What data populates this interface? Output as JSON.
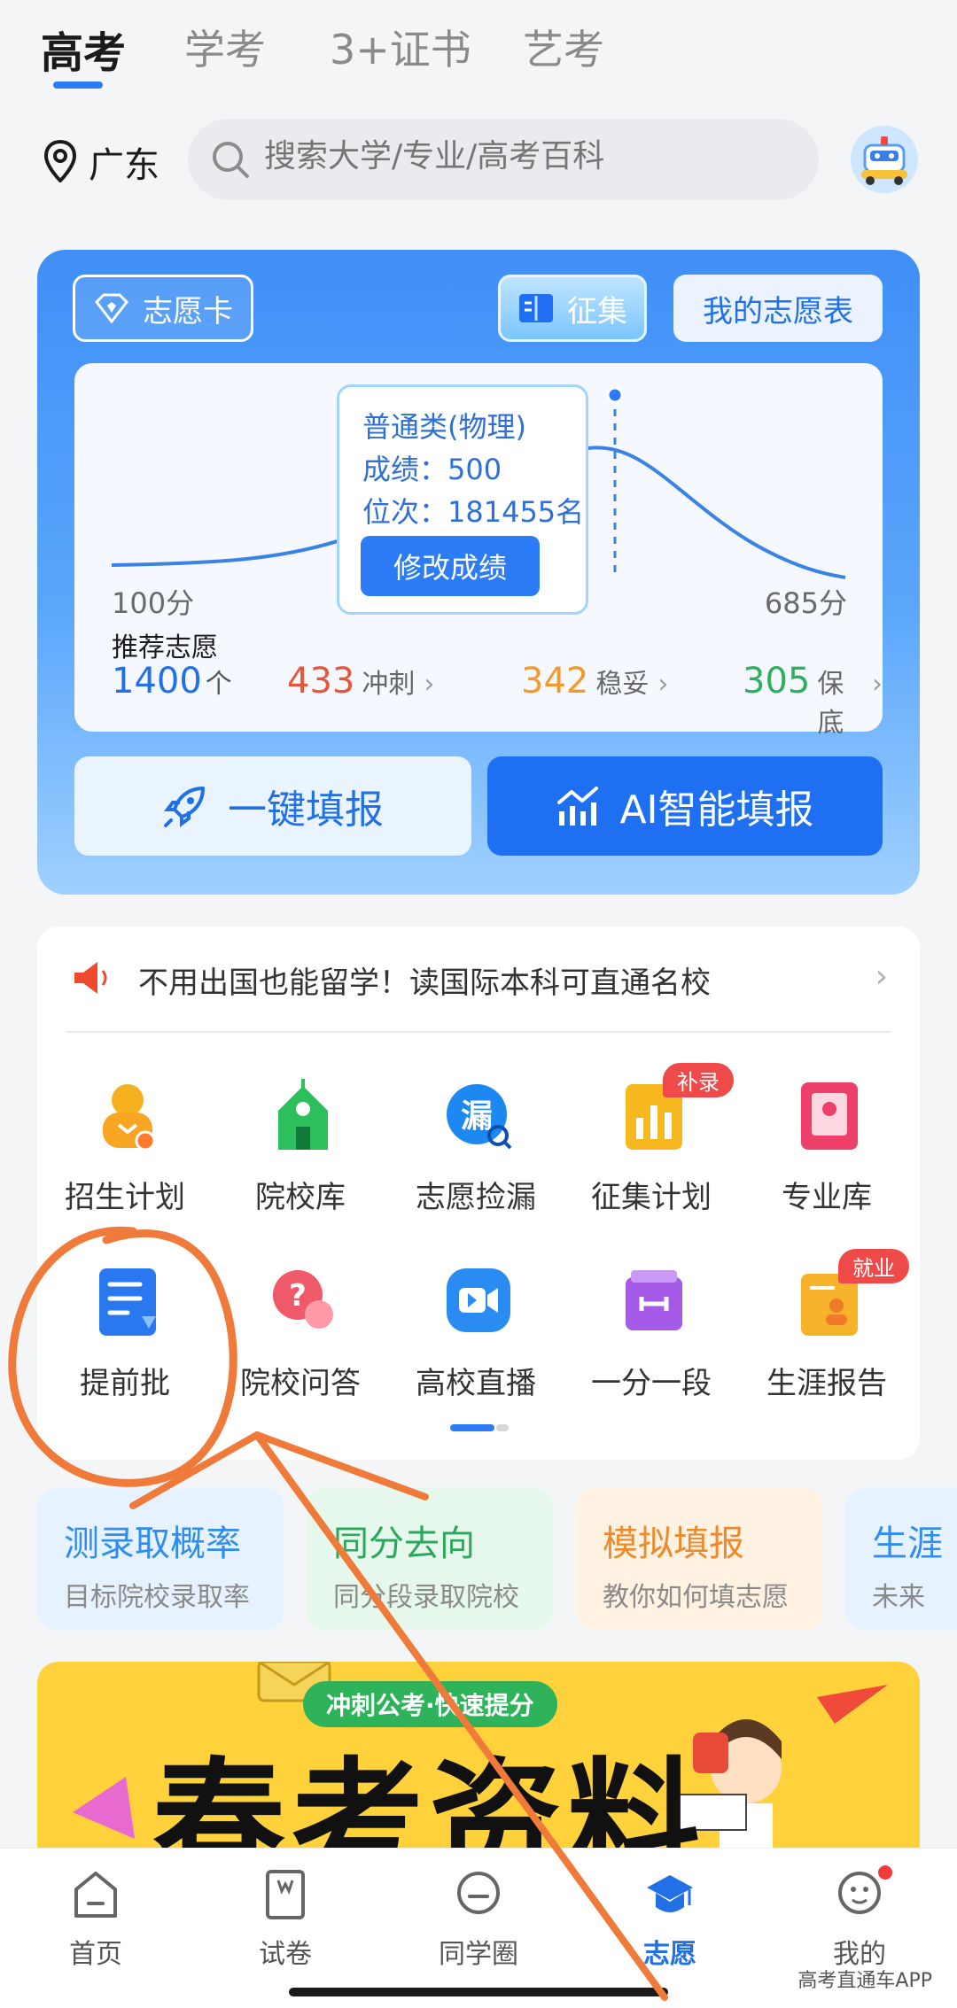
{
  "tabs": [
    "高考",
    "学考",
    "3+证书",
    "艺考"
  ],
  "location": "广东",
  "search": {
    "placeholder": "搜索大学/专业/高考百科"
  },
  "card": {
    "volunteer_card": "志愿卡",
    "collect": "征集",
    "my_table": "我的志愿表",
    "chart": {
      "min_label": "100分",
      "max_label": "685分",
      "tooltip": {
        "category": "普通类(物理)",
        "score": "成绩：500",
        "rank": "位次：181455名",
        "button": "修改成绩"
      }
    },
    "recommend_label": "推荐志愿",
    "recommend_count": "1400",
    "recommend_unit": "个",
    "stats": [
      {
        "num": "433",
        "label": "冲刺",
        "color": "#e8553a"
      },
      {
        "num": "342",
        "label": "稳妥",
        "color": "#f29a2e"
      },
      {
        "num": "305",
        "label": "保底",
        "color": "#2fae5f"
      }
    ],
    "quick_fill": "一键填报",
    "ai_fill": "AI智能填报"
  },
  "notice": "不用出国也能留学！读国际本科可直通名校",
  "grid": [
    {
      "label": "招生计划",
      "icon": "admission-plan-icon",
      "color": "#f6a623"
    },
    {
      "label": "院校库",
      "icon": "school-library-icon",
      "color": "#2cc05c"
    },
    {
      "label": "志愿捡漏",
      "icon": "volunteer-pickup-icon",
      "color": "#1e88f2",
      "glyph": "漏"
    },
    {
      "label": "征集计划",
      "icon": "collection-plan-icon",
      "color": "#f6b71f",
      "badge": "补录"
    },
    {
      "label": "专业库",
      "icon": "major-library-icon",
      "color": "#ee3f6a"
    },
    {
      "label": "提前批",
      "icon": "early-batch-icon",
      "color": "#2a78ef"
    },
    {
      "label": "院校问答",
      "icon": "school-qa-icon",
      "color": "#ef5a6a"
    },
    {
      "label": "高校直播",
      "icon": "live-stream-icon",
      "color": "#2a8cf2"
    },
    {
      "label": "一分一段",
      "icon": "score-segment-icon",
      "color": "#a55ae8"
    },
    {
      "label": "生涯报告",
      "icon": "career-report-icon",
      "color": "#f6b22a",
      "badge": "就业"
    }
  ],
  "features": [
    {
      "title": "测录取概率",
      "sub": "目标院校录取率",
      "color": "#2f8cf0",
      "bg": "#e6f2ff"
    },
    {
      "title": "同分去向",
      "sub": "同分段录取院校",
      "color": "#2aa85c",
      "bg": "#e6f7ec"
    },
    {
      "title": "模拟填报",
      "sub": "教你如何填志愿",
      "color": "#ee8a2a",
      "bg": "#fff2e3"
    },
    {
      "title": "生涯",
      "sub": "未来",
      "color": "#2f8cf0",
      "bg": "#e6f2ff"
    }
  ],
  "banner": {
    "tag": "冲刺公考·快速提分",
    "title": "春考资料"
  },
  "nav": [
    {
      "label": "首页",
      "icon": "home-icon"
    },
    {
      "label": "试卷",
      "icon": "exam-paper-icon"
    },
    {
      "label": "同学圈",
      "icon": "classmates-icon"
    },
    {
      "label": "志愿",
      "icon": "volunteer-cap-icon",
      "active": true
    },
    {
      "label": "我的",
      "icon": "profile-icon",
      "dot": true
    }
  ],
  "watermark": "高考直通车APP",
  "colors": {
    "accent": "#2b7cf6",
    "annotation": "#f07a3a"
  }
}
